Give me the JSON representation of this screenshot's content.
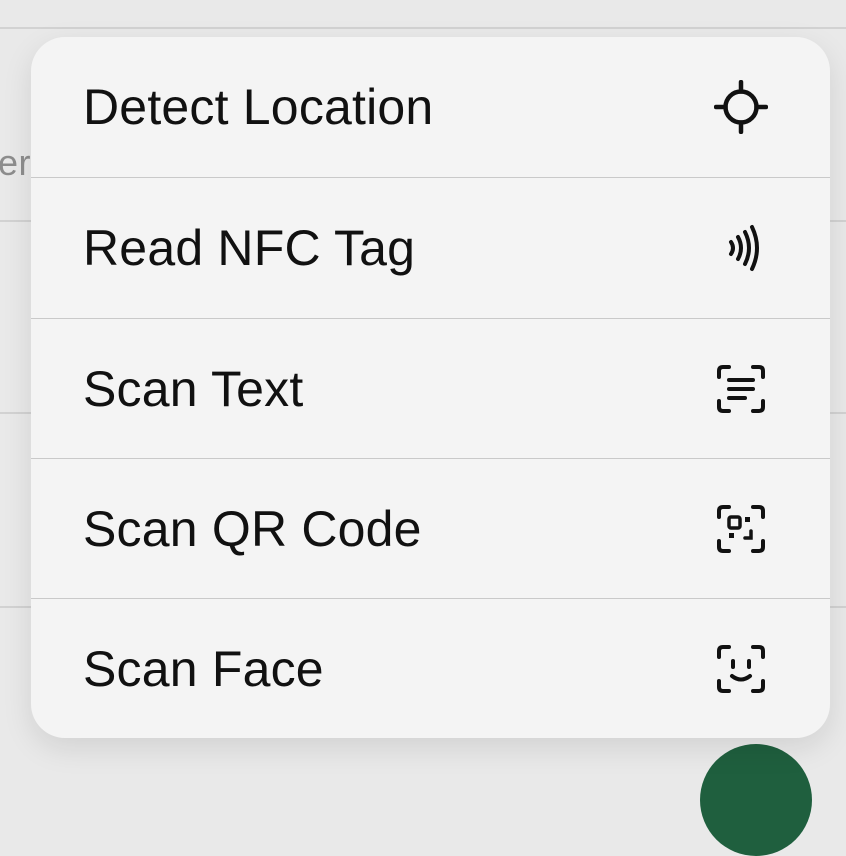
{
  "background": {
    "partial_text": "er"
  },
  "menu": {
    "items": [
      {
        "label": "Detect Location",
        "icon": "location-crosshair-icon"
      },
      {
        "label": "Read NFC Tag",
        "icon": "nfc-icon"
      },
      {
        "label": "Scan Text",
        "icon": "scan-text-icon"
      },
      {
        "label": "Scan QR Code",
        "icon": "scan-qr-icon"
      },
      {
        "label": "Scan Face",
        "icon": "scan-face-icon"
      }
    ]
  },
  "colors": {
    "background": "#e9e9e9",
    "menu_background": "#f4f4f4",
    "text": "#111111",
    "divider": "#c9c9c9",
    "fab": "#1f5f3e"
  }
}
